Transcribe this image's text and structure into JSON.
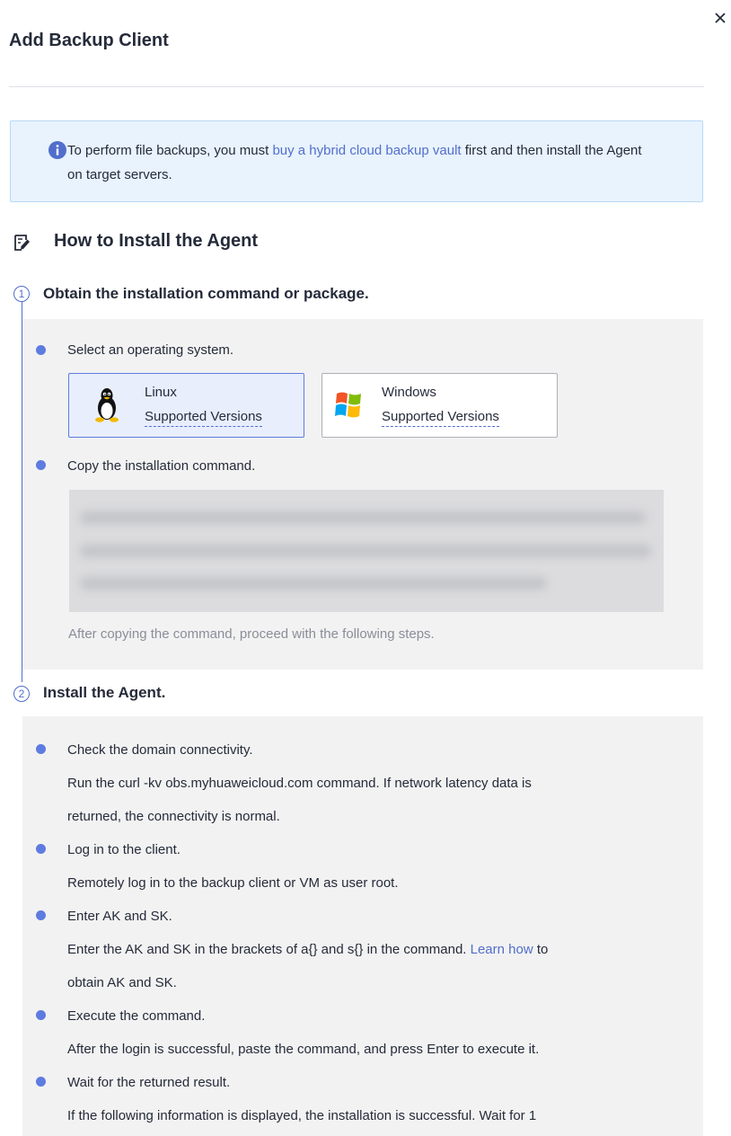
{
  "dialog": {
    "title": "Add Backup Client",
    "close_icon": "close-icon"
  },
  "info": {
    "icon": "info-icon",
    "before_link": "To perform file backups, you must ",
    "link": "buy a hybrid cloud backup vault",
    "after_link": " first and then install the Agent on target servers."
  },
  "howto": {
    "icon": "edit-note-icon",
    "title": "How to Install the Agent"
  },
  "step1": {
    "number": "1",
    "title": "Obtain the installation command or package.",
    "select_os": "Select an operating system.",
    "os_options": [
      {
        "name": "Linux",
        "versions": "Supported Versions",
        "icon": "linux-penguin-icon",
        "selected": true
      },
      {
        "name": "Windows",
        "versions": "Supported Versions",
        "icon": "windows-logo-icon",
        "selected": false
      }
    ],
    "copy_command": "Copy the installation command.",
    "hint": "After copying the command, proceed with the following steps."
  },
  "step2": {
    "number": "2",
    "title": "Install the Agent.",
    "items": [
      {
        "heading": "Check the domain connectivity.",
        "lines": [
          "Run the curl -kv obs.myhuaweicloud.com command. If network latency data is",
          "returned, the connectivity is normal."
        ]
      },
      {
        "heading": "Log in to the client.",
        "lines": [
          "Remotely log in to the backup client or VM as user root."
        ]
      },
      {
        "heading": "Enter AK and SK.",
        "line1_before": "Enter the AK and SK in the brackets of a{} and s{} in the command. ",
        "line1_link": "Learn how",
        "line1_after": " to",
        "line2": "obtain AK and SK."
      },
      {
        "heading": "Execute the command.",
        "lines": [
          "After the login is successful, paste the command, and press Enter to execute it."
        ]
      },
      {
        "heading": "Wait for the returned result.",
        "lines": [
          "If the following information is displayed, the installation is successful. Wait for 1"
        ]
      }
    ]
  },
  "colors": {
    "accent": "#526ecc",
    "bullet": "#5e7ce0",
    "info_bg": "#e8f3fd",
    "panel_bg": "#f2f2f2"
  }
}
